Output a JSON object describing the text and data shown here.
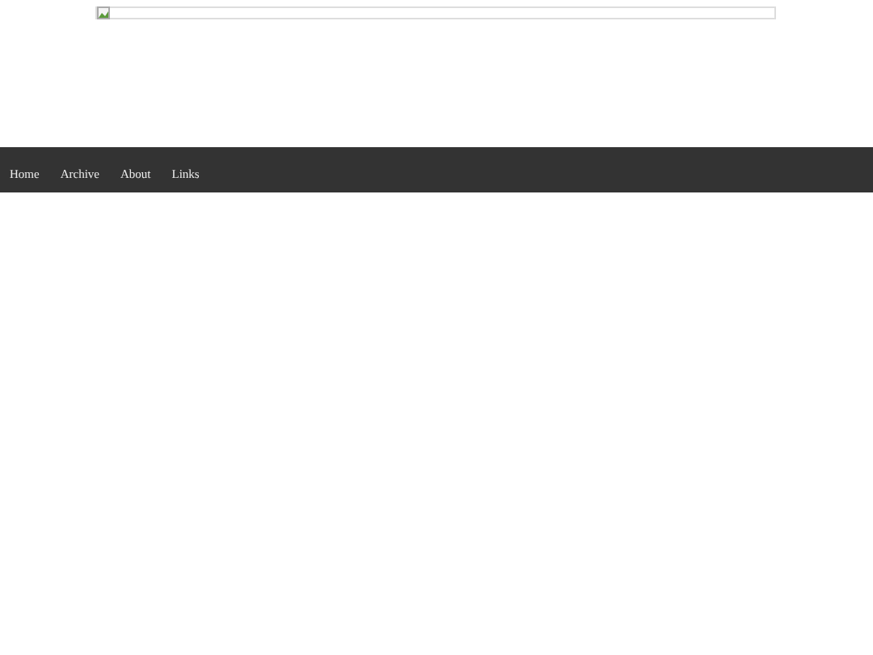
{
  "header": {
    "banner": {
      "kind": "broken-image"
    }
  },
  "nav": {
    "items": [
      {
        "label": "Home"
      },
      {
        "label": "Archive"
      },
      {
        "label": "About"
      },
      {
        "label": "Links"
      }
    ]
  }
}
